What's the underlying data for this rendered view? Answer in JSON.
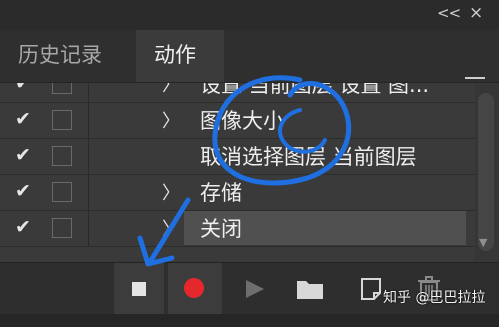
{
  "header": {
    "collapse_glyph": "<<",
    "close_glyph": "×"
  },
  "tabs": [
    {
      "label": "历史记录"
    },
    {
      "label": "动作"
    }
  ],
  "rows": [
    {
      "label": "设置 当前图层 设置 图...",
      "checked": true
    },
    {
      "label": "图像大小",
      "checked": true
    },
    {
      "label": "取消选择图层 当前图层",
      "checked": true
    },
    {
      "label": "存储",
      "checked": true
    },
    {
      "label": "关闭",
      "checked": true,
      "selected": true
    }
  ],
  "glyphs": {
    "check": "✔",
    "expand": "〉",
    "scroll_down": "▼"
  },
  "toolbar": {
    "stop_label": "停止播放/记录",
    "record_label": "开始记录",
    "play_label": "播放选定的动作",
    "folder_label": "创建新组",
    "new_label": "创建新动作",
    "delete_label": "删除"
  },
  "watermark": "知乎 @巴巴拉拉",
  "colors": {
    "record": "#e5282d",
    "annotation": "#1f6fe0"
  },
  "icons": [
    "collapse-icon",
    "close-icon",
    "panel-menu-icon",
    "checkmark-icon",
    "expand-arrow-icon",
    "stop-icon",
    "record-icon",
    "play-icon",
    "folder-icon",
    "new-action-icon",
    "trash-icon"
  ]
}
